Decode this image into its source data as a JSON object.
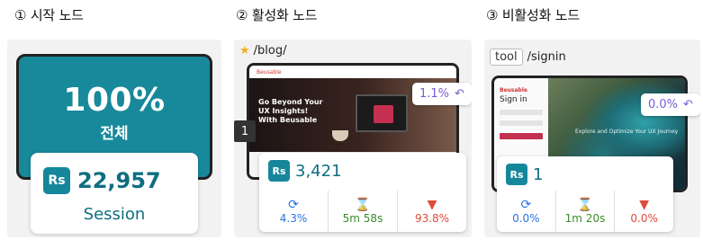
{
  "panels": [
    {
      "title": "① 시작 노드",
      "percent": "100%",
      "scope": "전체",
      "count": "22,957",
      "count_label": "Session",
      "user_icon_text": "Rs"
    },
    {
      "title": "② 활성화 노드",
      "url": "/blog/",
      "step_number": "1",
      "percent": "1.1%",
      "user_icon_text": "Rs",
      "count": "3,421",
      "metrics": {
        "returning": "4.3%",
        "time": "5m 58s",
        "exit": "93.8%"
      },
      "thumb": {
        "nav_logo": "Beusable",
        "hero_text": [
          "Go Beyond Your",
          "UX Insights!",
          "With Beusable"
        ]
      }
    },
    {
      "title": "③ 비활성화 노드",
      "tag": "tool",
      "url": "/signin",
      "percent": "0.0%",
      "user_icon_text": "Rs",
      "count": "1",
      "metrics": {
        "returning": "0.0%",
        "time": "1m 20s",
        "exit": "0.0%"
      },
      "thumb": {
        "logo": "Beusable",
        "heading": "Sign in",
        "caption": "Explore and Optimize Your UX Journey"
      }
    }
  ],
  "colors": {
    "teal": "#17899a",
    "purple": "#7a5bd6",
    "blue": "#2a72e0",
    "green": "#3b8a2a",
    "red": "#e04a3a"
  },
  "icons": [
    "star-icon",
    "user-icon",
    "refresh-icon",
    "hourglass-icon",
    "exit-arrow-icon",
    "undo-arrow-icon"
  ]
}
